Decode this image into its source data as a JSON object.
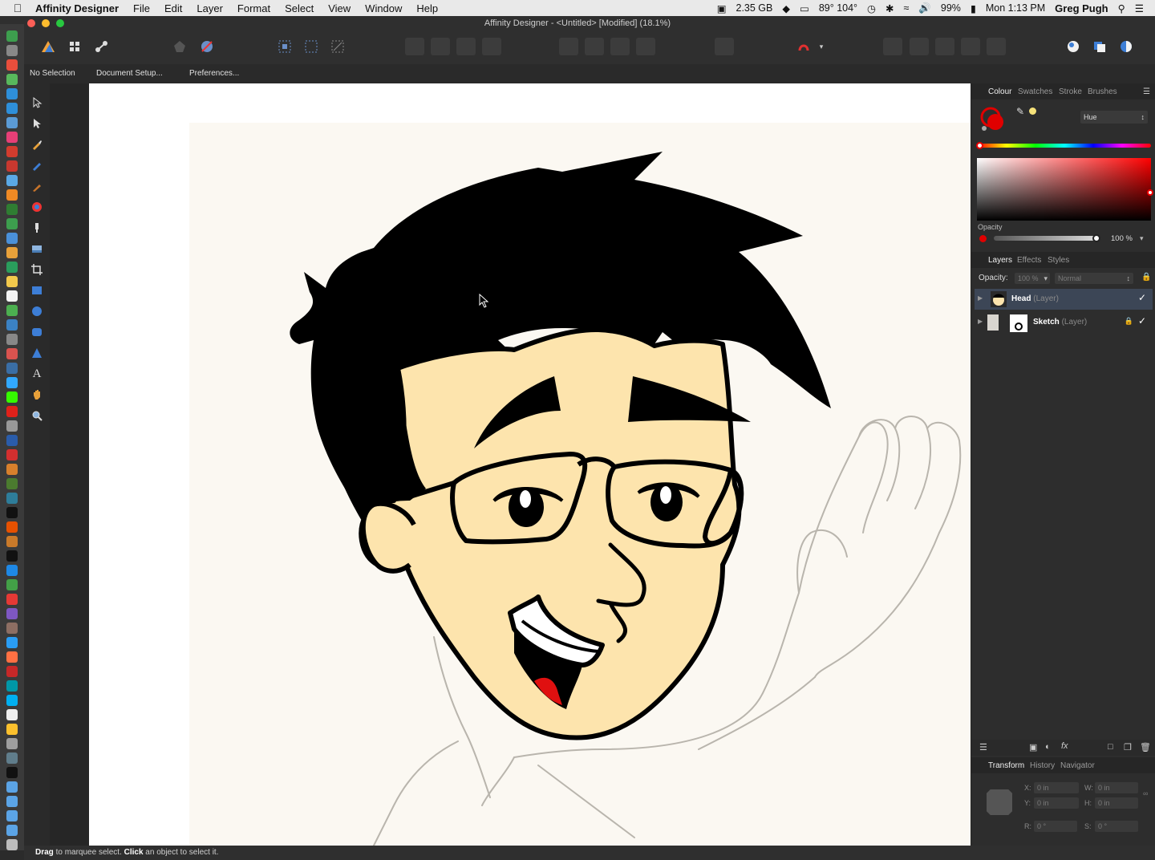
{
  "menubar": {
    "app_name": "Affinity Designer",
    "items": [
      "File",
      "Edit",
      "Layer",
      "Format",
      "Select",
      "View",
      "Window",
      "Help"
    ],
    "memory": "2.35 GB",
    "temperature": "89° 104°",
    "battery": "99%",
    "clock": "Mon 1:13 PM",
    "user": "Greg Pugh"
  },
  "window": {
    "title": "Affinity Designer - <Untitled> [Modified] (18.1%)"
  },
  "contextbar": {
    "selection": "No Selection",
    "document_setup": "Document Setup...",
    "preferences": "Preferences..."
  },
  "colour_panel": {
    "tabs": [
      "Colour",
      "Swatches",
      "Stroke",
      "Brushes"
    ],
    "mode": "Hue",
    "opacity_label": "Opacity",
    "opacity_value": "100 %",
    "fill_color": "#e00000"
  },
  "layers_panel": {
    "tabs": [
      "Layers",
      "Effects",
      "Styles"
    ],
    "opacity_label": "Opacity:",
    "opacity_value": "100 %",
    "blend_mode": "Normal",
    "layers": [
      {
        "name": "Head",
        "kind": "(Layer)"
      },
      {
        "name": "Sketch",
        "kind": "(Layer)"
      }
    ]
  },
  "transform_panel": {
    "tabs": [
      "Transform",
      "History",
      "Navigator"
    ],
    "x_label": "X:",
    "x_value": "0 in",
    "y_label": "Y:",
    "y_value": "0 in",
    "w_label": "W:",
    "w_value": "0 in",
    "h_label": "H:",
    "h_value": "0 in",
    "r_label": "R:",
    "r_value": "0 °",
    "s_label": "S:",
    "s_value": "0 °"
  },
  "status": {
    "drag": "Drag",
    "drag_text": " to marquee select. ",
    "click": "Click",
    "click_text": " an object to select it."
  }
}
